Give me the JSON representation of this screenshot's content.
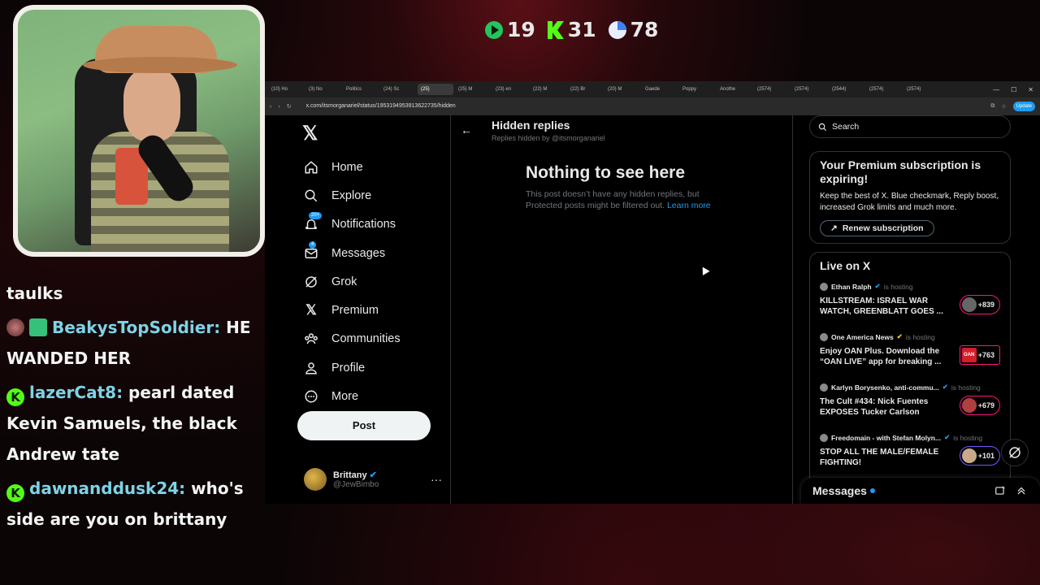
{
  "overlay": {
    "stats": [
      {
        "icon": "play-icon",
        "value": "19",
        "color": "#22c55e"
      },
      {
        "icon": "kick-icon",
        "value": "31",
        "color": "#53fc18"
      },
      {
        "icon": "pie-icon",
        "value": "78",
        "color": "#3b82f6"
      }
    ]
  },
  "chat": [
    {
      "user": "",
      "text": "taulks"
    },
    {
      "user": "BeakysTopSoldier:",
      "text": "HE WANDED HER"
    },
    {
      "user": "lazerCat8:",
      "text": "pearl dated Kevin Samuels, the black Andrew tate"
    },
    {
      "user": "dawnanddusk24:",
      "text": "who's side are you on brittany"
    }
  ],
  "browser": {
    "tabs": [
      "(10) Ho",
      "(3) No",
      "Politics",
      "(24) Sc",
      "(25)",
      "(25) M",
      "(23) en",
      "(22) M",
      "(22) Br",
      "(20) M",
      "Gaede",
      "Poppy",
      "Anothe",
      "(2574)",
      "(2574)",
      "(2544)",
      "(2574)",
      "(2574)",
      "(2574)"
    ],
    "active_tab": 4,
    "url": "x.com/itsmorganariel/status/1953194953913622735/hidden",
    "update_label": "Update"
  },
  "nav": {
    "items": [
      {
        "label": "Home",
        "icon": "home-icon"
      },
      {
        "label": "Explore",
        "icon": "search-icon"
      },
      {
        "label": "Notifications",
        "icon": "bell-icon",
        "badge": "20+"
      },
      {
        "label": "Messages",
        "icon": "mail-icon",
        "badge": "4"
      },
      {
        "label": "Grok",
        "icon": "grok-icon"
      },
      {
        "label": "Premium",
        "icon": "x-logo-icon"
      },
      {
        "label": "Communities",
        "icon": "people-icon"
      },
      {
        "label": "Profile",
        "icon": "person-icon"
      },
      {
        "label": "More",
        "icon": "more-circle-icon"
      }
    ],
    "post_label": "Post"
  },
  "account": {
    "name": "Brittany",
    "handle": "@JewBimbo"
  },
  "main": {
    "title": "Hidden replies",
    "subtitle": "Replies hidden by @itsmorganariel",
    "empty_title": "Nothing to see here",
    "empty_body": "This post doesn’t have any hidden replies, but Protected posts might be filtered out. ",
    "learn_more": "Learn more"
  },
  "sidebar": {
    "search_placeholder": "Search",
    "premium_title": "Your Premium subscription is expiring!",
    "premium_body": "Keep the best of X. Blue checkmark, Reply boost, increased Grok limits and much more.",
    "renew_label": "Renew subscription",
    "live_title": "Live on X",
    "hosting_label": "is hosting",
    "live_items": [
      {
        "host": "Ethan Ralph",
        "title": "KILLSTREAM: ISRAEL WAR WATCH, GREENBLATT GOES ...",
        "count": "+839"
      },
      {
        "host": "One America News",
        "title": "Enjoy OAN Plus. Download the “OAN LIVE” app for breaking ...",
        "count": "+763",
        "logo": "OAN"
      },
      {
        "host": "Karlyn Borysenko, anti-commu...",
        "title": "The Cult #434: Nick Fuentes EXPOSES Tucker Carlson",
        "count": "+679"
      },
      {
        "host": "Freedomain - with Stefan Molyn...",
        "title": "STOP ALL THE MALE/FEMALE FIGHTING!",
        "count": "+101"
      }
    ]
  },
  "messages_drawer": {
    "label": "Messages"
  }
}
